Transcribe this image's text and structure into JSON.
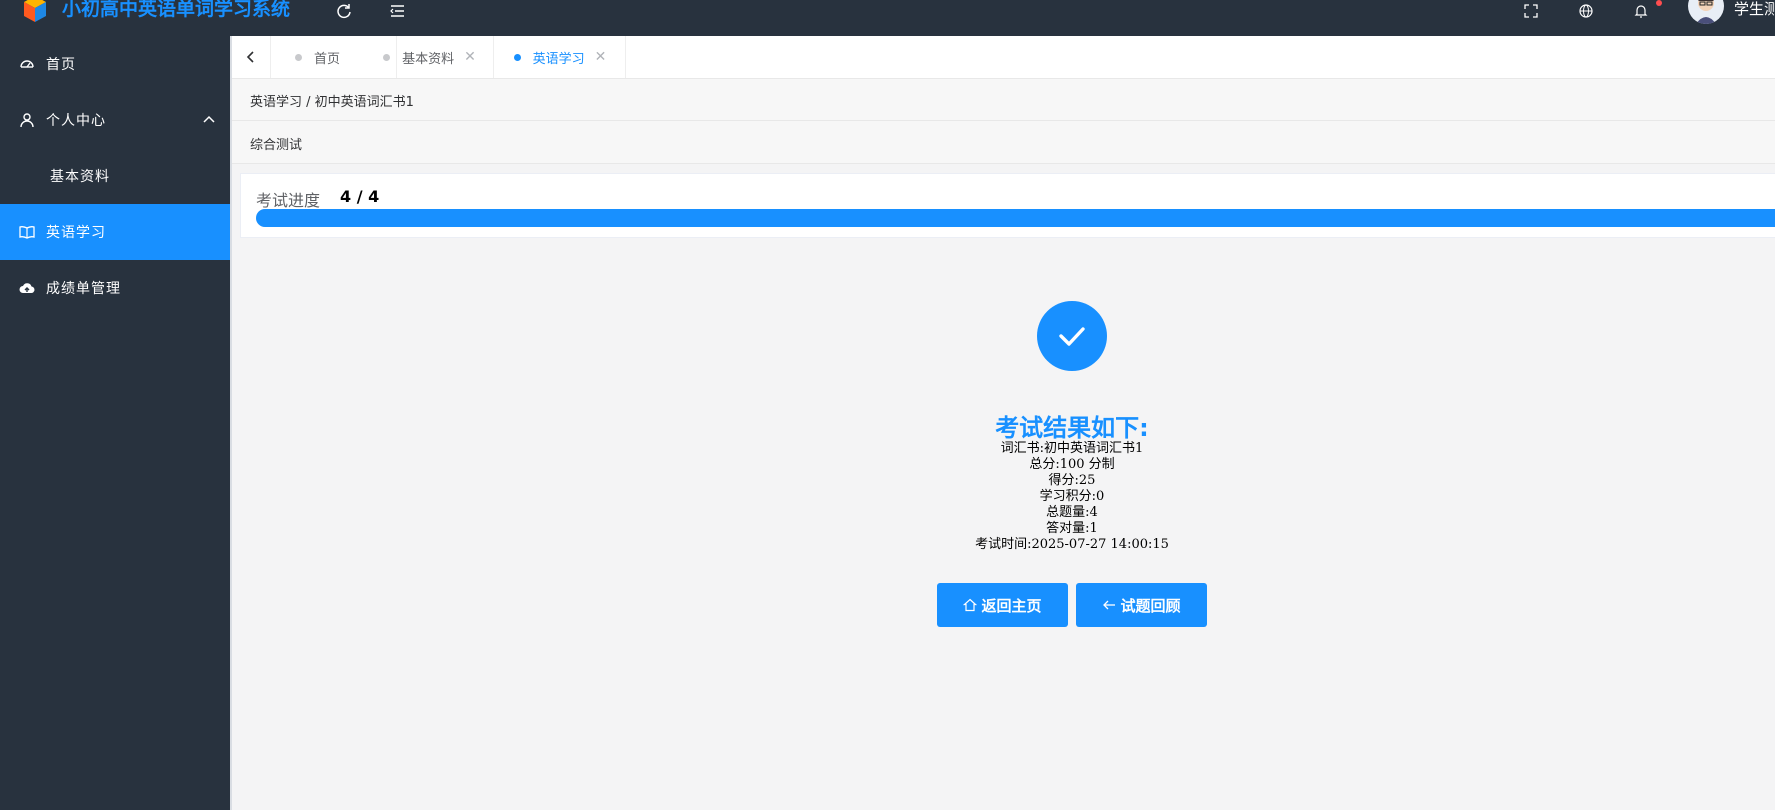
{
  "header": {
    "app_title": "小初高中英语单词学习系统",
    "user_name": "学生测"
  },
  "sidebar": {
    "items": [
      {
        "label": "首页",
        "icon": "dashboard-icon"
      },
      {
        "label": "个人中心",
        "icon": "user-icon"
      },
      {
        "label": "基本资料"
      },
      {
        "label": "英语学习",
        "icon": "book-icon"
      },
      {
        "label": "成绩单管理",
        "icon": "cloud-upload-icon"
      }
    ]
  },
  "tabs": [
    {
      "label": "首页"
    },
    {
      "label": "基本资料"
    },
    {
      "label": "英语学习"
    }
  ],
  "breadcrumb": "英语学习 / 初中英语词汇书1",
  "page_title": "综合测试",
  "progress": {
    "label": "考试进度",
    "count": "4 / 4",
    "fraction": 1.0
  },
  "result": {
    "title": "考试结果如下:",
    "lines": [
      "词汇书:初中英语词汇书1",
      "总分:100 分制",
      "得分:25",
      "学习积分:0",
      "总题量:4",
      "答对量:1",
      "考试时间:2025-07-27 14:00:15"
    ]
  },
  "buttons": {
    "home": "返回主页",
    "review": "试题回顾"
  },
  "colors": {
    "accent": "#1890ff",
    "sidebar_bg": "#28323e"
  }
}
